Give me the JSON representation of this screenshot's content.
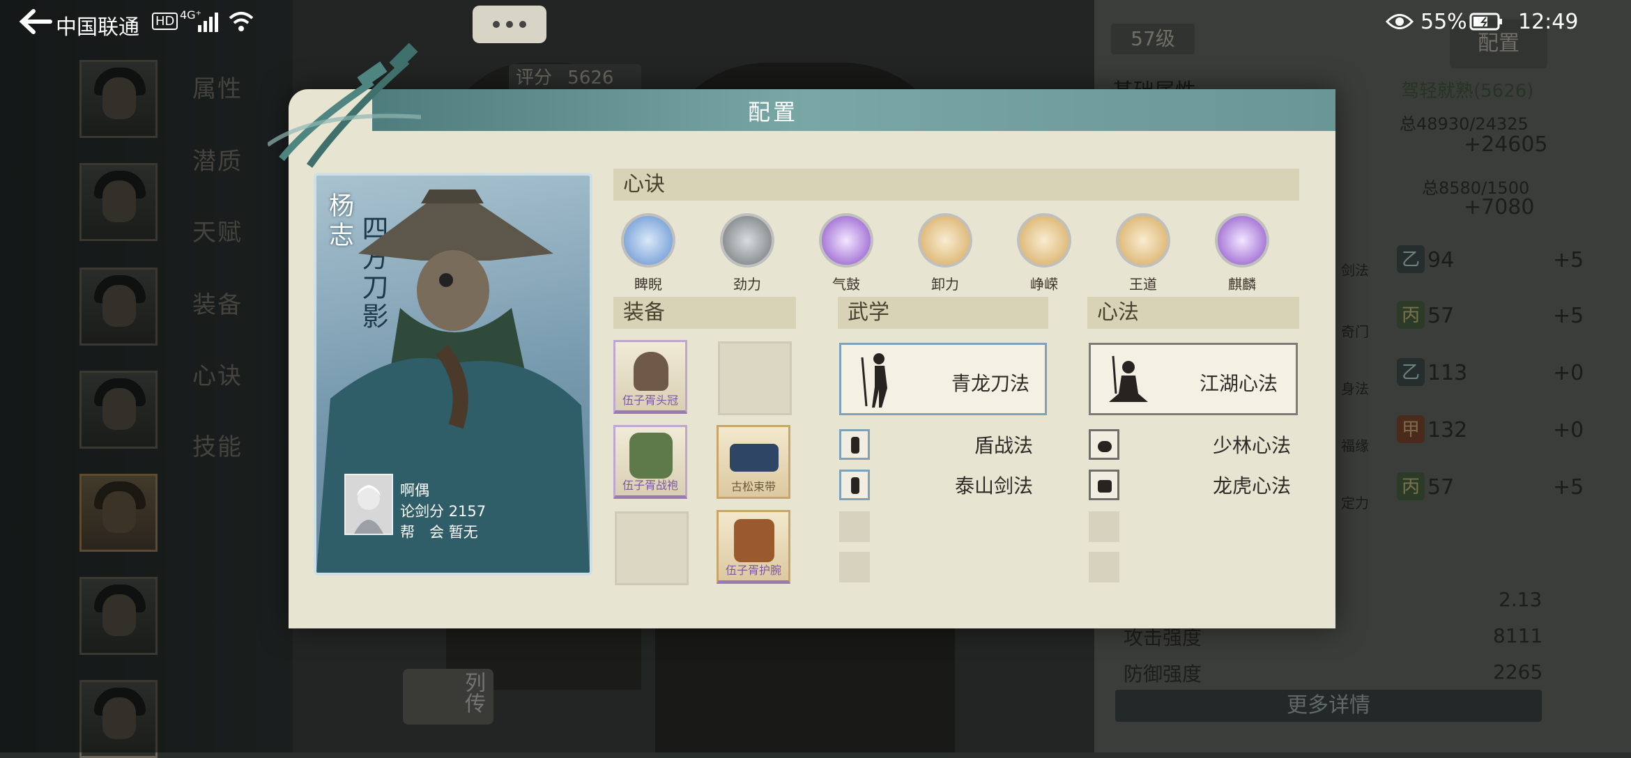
{
  "status_bar": {
    "carrier": "中国联通",
    "hd": "HD",
    "network": "4G⁺",
    "battery_pct": "55%",
    "time": "12:49"
  },
  "top": {
    "score_label": "评分",
    "score_value": "5626",
    "level": "57级",
    "config_btn": "配置"
  },
  "side_tabs": [
    "属性",
    "潜质",
    "天赋",
    "装备",
    "心诀",
    "技能"
  ],
  "right_panel": {
    "base_attr": "基础属性",
    "mastery": "驾轻就熟(5626)",
    "total1": "总48930/24325",
    "bonus1": "+24605",
    "total2": "总8580/1500",
    "bonus2": "+7080",
    "stats": [
      {
        "name": "剑法",
        "grade": "乙",
        "value": "94",
        "bonus": "+5"
      },
      {
        "name": "奇门",
        "grade": "丙",
        "value": "57",
        "bonus": "+5"
      },
      {
        "name": "身法",
        "grade": "乙",
        "value": "113",
        "bonus": "+0"
      },
      {
        "name": "福缘",
        "grade": "甲",
        "value": "132",
        "bonus": "+0"
      },
      {
        "name": "定力",
        "grade": "丙",
        "value": "57",
        "bonus": "+5"
      }
    ],
    "extra_value": "2.13",
    "attack_label": "攻击强度",
    "attack_value": "8111",
    "defense_label": "防御强度",
    "defense_value": "2265",
    "more_details": "更多详情"
  },
  "biography_btn": "列传",
  "dialog": {
    "title": "配置",
    "hero": {
      "name": "杨志",
      "title": "四方刀影"
    },
    "player": {
      "name": "啊偶",
      "rank_label": "论剑分",
      "rank_value": "2157",
      "guild_label": "帮　会",
      "guild_value": "暂无"
    },
    "xinjue_header": "心诀",
    "xinjue": [
      {
        "name": "睥睨",
        "color": "#5f8fd0"
      },
      {
        "name": "劲力",
        "color": "#6d7378"
      },
      {
        "name": "气鼓",
        "color": "#8a4fc8"
      },
      {
        "name": "卸力",
        "color": "#d6a85a"
      },
      {
        "name": "峥嵘",
        "color": "#d6a85a"
      },
      {
        "name": "王道",
        "color": "#d6a85a"
      },
      {
        "name": "麒麟",
        "color": "#8a4fc8"
      }
    ],
    "equip_header": "装备",
    "equipment": [
      {
        "name": "伍子胥头冠"
      },
      {
        "name": ""
      },
      {
        "name": "伍子胥战袍"
      },
      {
        "name": "古松束带"
      },
      {
        "name": ""
      },
      {
        "name": "伍子胥护腕"
      }
    ],
    "wuxue_header": "武学",
    "wuxue_main": "青龙刀法",
    "wuxue_list": [
      "盾战法",
      "泰山剑法"
    ],
    "xinfa_header": "心法",
    "xinfa_main": "江湖心法",
    "xinfa_list": [
      "少林心法",
      "龙虎心法"
    ]
  }
}
